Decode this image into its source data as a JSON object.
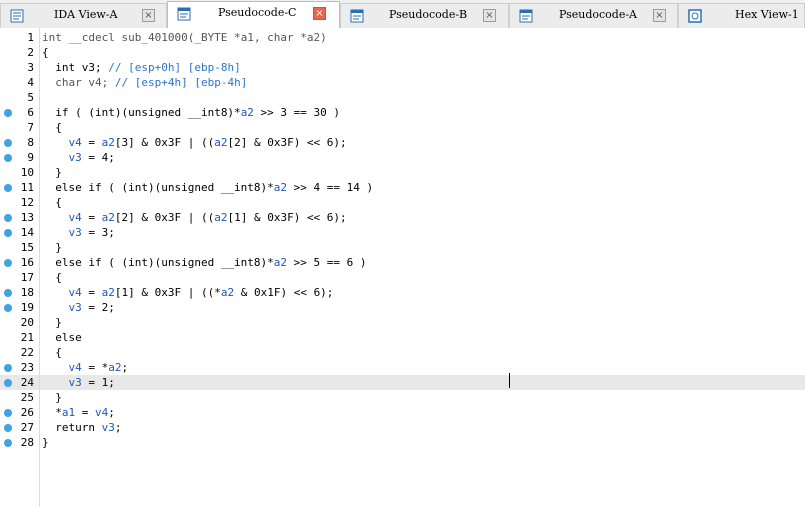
{
  "tabs": [
    {
      "label": "IDA View-A",
      "active": false,
      "icon": "disassembly-view-icon"
    },
    {
      "label": "Pseudocode-C",
      "active": true,
      "icon": "pseudocode-icon"
    },
    {
      "label": "Pseudocode-B",
      "active": false,
      "icon": "pseudocode-icon"
    },
    {
      "label": "Pseudocode-A",
      "active": false,
      "icon": "pseudocode-icon"
    },
    {
      "label": "Hex View-1",
      "active": false,
      "icon": "hex-view-icon"
    }
  ],
  "colors": {
    "breakpoint_dot": "#3fa3e0",
    "variable": "#1c57b8",
    "comment": "#2d73c9",
    "current_line": "#e8e8e8",
    "active_close": "#e8664c"
  },
  "current_line": 24,
  "lines": [
    {
      "n": "1",
      "dot": false,
      "indent": "",
      "tokens": [
        {
          "t": "int __cdecl sub_401000(_BYTE *",
          "c": "muted"
        },
        {
          "t": "a1",
          "c": "muted"
        },
        {
          "t": ", char *",
          "c": "muted"
        },
        {
          "t": "a2",
          "c": "muted"
        },
        {
          "t": ")",
          "c": "muted"
        }
      ]
    },
    {
      "n": "2",
      "dot": false,
      "indent": "",
      "tokens": [
        {
          "t": "{",
          "c": "plain"
        }
      ]
    },
    {
      "n": "3",
      "dot": false,
      "indent": "  ",
      "tokens": [
        {
          "t": "int v3; ",
          "c": "plain"
        },
        {
          "t": "// [esp+0h] [ebp-8h]",
          "c": "cmt"
        }
      ]
    },
    {
      "n": "4",
      "dot": false,
      "indent": "  ",
      "tokens": [
        {
          "t": "char v4; ",
          "c": "muted"
        },
        {
          "t": "// [esp+4h] [ebp-4h]",
          "c": "cmt"
        }
      ]
    },
    {
      "n": "5",
      "dot": false,
      "indent": "",
      "tokens": []
    },
    {
      "n": "6",
      "dot": true,
      "indent": "  ",
      "tokens": [
        {
          "t": "if ( (int)(unsigned __int8)*",
          "c": "plain"
        },
        {
          "t": "a2",
          "c": "var"
        },
        {
          "t": " >> 3 == 30 )",
          "c": "plain"
        }
      ]
    },
    {
      "n": "7",
      "dot": false,
      "indent": "  ",
      "tokens": [
        {
          "t": "{",
          "c": "plain"
        }
      ]
    },
    {
      "n": "8",
      "dot": true,
      "indent": "    ",
      "tokens": [
        {
          "t": "v4",
          "c": "var"
        },
        {
          "t": " = ",
          "c": "plain"
        },
        {
          "t": "a2",
          "c": "var"
        },
        {
          "t": "[3] & 0x3F | ((",
          "c": "plain"
        },
        {
          "t": "a2",
          "c": "var"
        },
        {
          "t": "[2] & 0x3F) << 6);",
          "c": "plain"
        }
      ]
    },
    {
      "n": "9",
      "dot": true,
      "indent": "    ",
      "tokens": [
        {
          "t": "v3",
          "c": "var"
        },
        {
          "t": " = 4;",
          "c": "plain"
        }
      ]
    },
    {
      "n": "10",
      "dot": false,
      "indent": "  ",
      "tokens": [
        {
          "t": "}",
          "c": "plain"
        }
      ]
    },
    {
      "n": "11",
      "dot": true,
      "indent": "  ",
      "tokens": [
        {
          "t": "else if ( (int)(unsigned __int8)*",
          "c": "plain"
        },
        {
          "t": "a2",
          "c": "var"
        },
        {
          "t": " >> 4 == 14 )",
          "c": "plain"
        }
      ]
    },
    {
      "n": "12",
      "dot": false,
      "indent": "  ",
      "tokens": [
        {
          "t": "{",
          "c": "plain"
        }
      ]
    },
    {
      "n": "13",
      "dot": true,
      "indent": "    ",
      "tokens": [
        {
          "t": "v4",
          "c": "var"
        },
        {
          "t": " = ",
          "c": "plain"
        },
        {
          "t": "a2",
          "c": "var"
        },
        {
          "t": "[2] & 0x3F | ((",
          "c": "plain"
        },
        {
          "t": "a2",
          "c": "var"
        },
        {
          "t": "[1] & 0x3F) << 6);",
          "c": "plain"
        }
      ]
    },
    {
      "n": "14",
      "dot": true,
      "indent": "    ",
      "tokens": [
        {
          "t": "v3",
          "c": "var"
        },
        {
          "t": " = 3;",
          "c": "plain"
        }
      ]
    },
    {
      "n": "15",
      "dot": false,
      "indent": "  ",
      "tokens": [
        {
          "t": "}",
          "c": "plain"
        }
      ]
    },
    {
      "n": "16",
      "dot": true,
      "indent": "  ",
      "tokens": [
        {
          "t": "else if ( (int)(unsigned __int8)*",
          "c": "plain"
        },
        {
          "t": "a2",
          "c": "var"
        },
        {
          "t": " >> 5 == 6 )",
          "c": "plain"
        }
      ]
    },
    {
      "n": "17",
      "dot": false,
      "indent": "  ",
      "tokens": [
        {
          "t": "{",
          "c": "plain"
        }
      ]
    },
    {
      "n": "18",
      "dot": true,
      "indent": "    ",
      "tokens": [
        {
          "t": "v4",
          "c": "var"
        },
        {
          "t": " = ",
          "c": "plain"
        },
        {
          "t": "a2",
          "c": "var"
        },
        {
          "t": "[1] & 0x3F | ((*",
          "c": "plain"
        },
        {
          "t": "a2",
          "c": "var"
        },
        {
          "t": " & 0x1F) << 6);",
          "c": "plain"
        }
      ]
    },
    {
      "n": "19",
      "dot": true,
      "indent": "    ",
      "tokens": [
        {
          "t": "v3",
          "c": "var"
        },
        {
          "t": " = 2;",
          "c": "plain"
        }
      ]
    },
    {
      "n": "20",
      "dot": false,
      "indent": "  ",
      "tokens": [
        {
          "t": "}",
          "c": "plain"
        }
      ]
    },
    {
      "n": "21",
      "dot": false,
      "indent": "  ",
      "tokens": [
        {
          "t": "else",
          "c": "plain"
        }
      ]
    },
    {
      "n": "22",
      "dot": false,
      "indent": "  ",
      "tokens": [
        {
          "t": "{",
          "c": "plain"
        }
      ]
    },
    {
      "n": "23",
      "dot": true,
      "indent": "    ",
      "tokens": [
        {
          "t": "v4",
          "c": "var"
        },
        {
          "t": " = *",
          "c": "plain"
        },
        {
          "t": "a2",
          "c": "var"
        },
        {
          "t": ";",
          "c": "plain"
        }
      ]
    },
    {
      "n": "24",
      "dot": true,
      "indent": "    ",
      "tokens": [
        {
          "t": "v3",
          "c": "var"
        },
        {
          "t": " = 1;",
          "c": "plain"
        }
      ]
    },
    {
      "n": "25",
      "dot": false,
      "indent": "  ",
      "tokens": [
        {
          "t": "}",
          "c": "plain"
        }
      ]
    },
    {
      "n": "26",
      "dot": true,
      "indent": "  ",
      "tokens": [
        {
          "t": "*",
          "c": "plain"
        },
        {
          "t": "a1",
          "c": "var"
        },
        {
          "t": " = ",
          "c": "plain"
        },
        {
          "t": "v4",
          "c": "var"
        },
        {
          "t": ";",
          "c": "plain"
        }
      ]
    },
    {
      "n": "27",
      "dot": true,
      "indent": "  ",
      "tokens": [
        {
          "t": "return ",
          "c": "plain"
        },
        {
          "t": "v3",
          "c": "var"
        },
        {
          "t": ";",
          "c": "plain"
        }
      ]
    },
    {
      "n": "28",
      "dot": true,
      "indent": "",
      "tokens": [
        {
          "t": "}",
          "c": "plain"
        }
      ]
    }
  ]
}
